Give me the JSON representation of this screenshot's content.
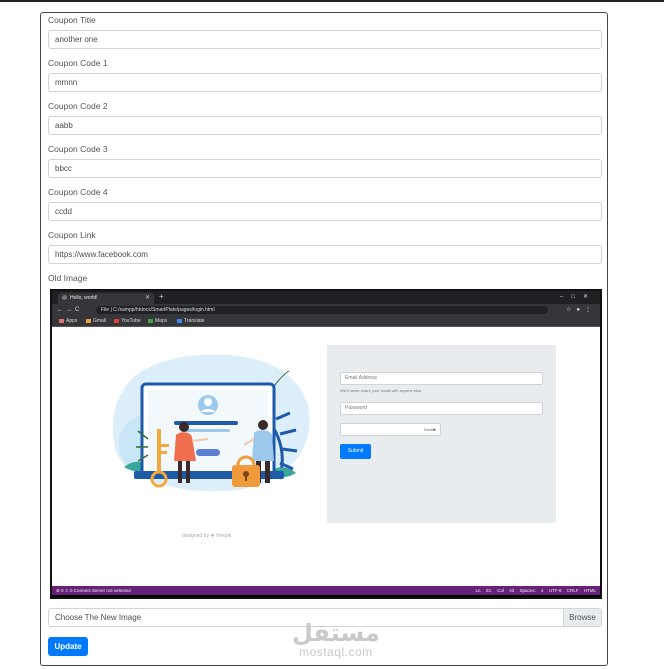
{
  "form": {
    "fields": [
      {
        "label": "Coupon Title",
        "value": "another one"
      },
      {
        "label": "Coupon Code 1",
        "value": "mmnn"
      },
      {
        "label": "Coupon Code 2",
        "value": "aabb"
      },
      {
        "label": "Coupon Code 3",
        "value": "bbcc"
      },
      {
        "label": "Coupon Code 4",
        "value": "ccdd"
      },
      {
        "label": "Coupon Link",
        "value": "https://www.facebook.com"
      }
    ],
    "old_image_label": "Old Image",
    "file_input": {
      "placeholder": "Choose The New Image",
      "browse_label": "Browse"
    },
    "submit_label": "Update"
  },
  "preview": {
    "tab_title": "Hello, world!",
    "address": "File  |  C:/xampp/htdocs/SmartPlate/pages/login.html",
    "bookmarks": [
      "Apps",
      "Gmail",
      "YouTube",
      "Maps",
      "Translate"
    ],
    "email_placeholder": "Email Address",
    "email_help": "We'll never share your email with anyone else.",
    "password_placeholder": "Password",
    "select_value": "Doctor",
    "submit_label": "Submit",
    "credit": "designed by ❖ freepik",
    "status_left": "⊗ 0 ⚠ 0    Connect    Server not selected",
    "status_right": "Ln 23, Col 43  Spaces: 4  UTF-8  CRLF  HTML"
  },
  "watermark": {
    "arabic": "مستقل",
    "latin": "mostaql.com"
  },
  "colors": {
    "primary": "#007bff",
    "status_bar": "#68217a"
  }
}
